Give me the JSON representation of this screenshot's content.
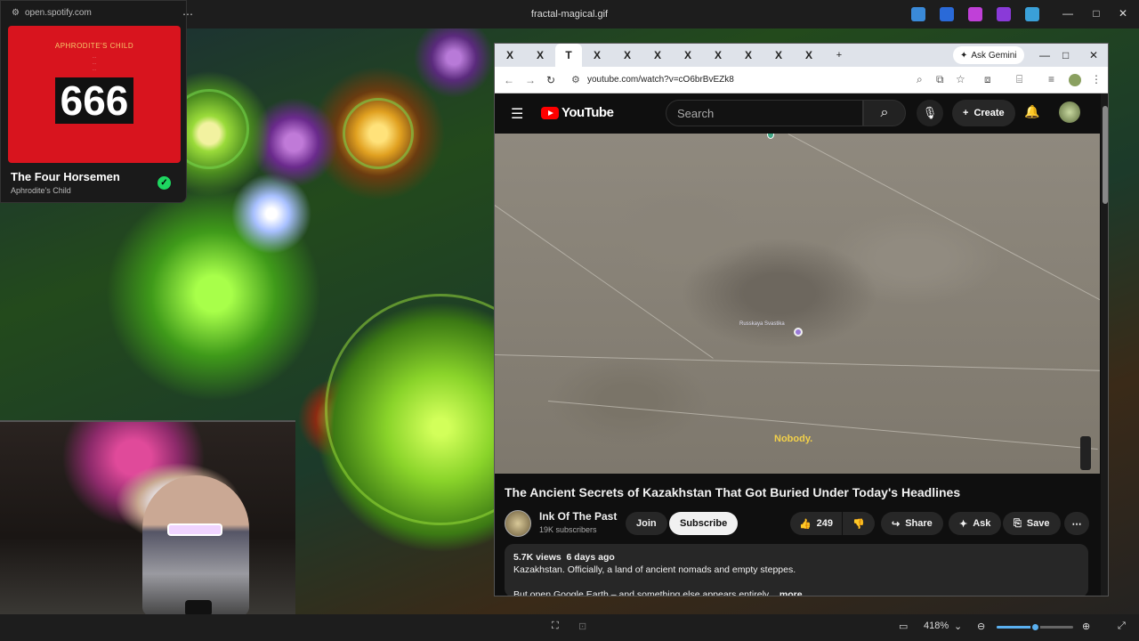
{
  "window": {
    "title": "fractal-magical.gif"
  },
  "spotify": {
    "url": "open.spotify.com",
    "album_artist": "APHRODITE'S CHILD",
    "album_number": "666",
    "song": "The Four Horsemen",
    "artist": "Aphrodite's Child"
  },
  "bottombar": {
    "zoom": "418%",
    "zoom_level": 0.5
  },
  "browser": {
    "tabs": [
      "X",
      "X",
      "T",
      "X",
      "X",
      "X",
      "X",
      "X",
      "X",
      "X",
      "X"
    ],
    "gemini": "Ask Gemini",
    "url": "youtube.com/watch?v=cO6brBvEZk8"
  },
  "youtube": {
    "logo": "YouTube",
    "search_placeholder": "Search",
    "create": "Create",
    "video": {
      "place_label": "Russkaya Svastika",
      "caption": "Nobody.",
      "title": "The Ancient Secrets of Kazakhstan That Got Buried Under Today's Headlines"
    },
    "channel": {
      "name": "Ink Of The Past",
      "subs": "19K subscribers"
    },
    "join": "Join",
    "subscribe": "Subscribe",
    "likes": "249",
    "share": "Share",
    "ask": "Ask",
    "save": "Save",
    "desc": {
      "views": "5.7K views",
      "date": "6 days ago",
      "line1": "Kazakhstan. Officially, a land of ancient nomads and empty steppes.",
      "line2": "But open Google Earth – and something else appears entirely",
      "more": "...more"
    }
  },
  "colors": {
    "accent": "#ff0000",
    "spotify_green": "#1ed760",
    "album_red": "#d8141e"
  }
}
